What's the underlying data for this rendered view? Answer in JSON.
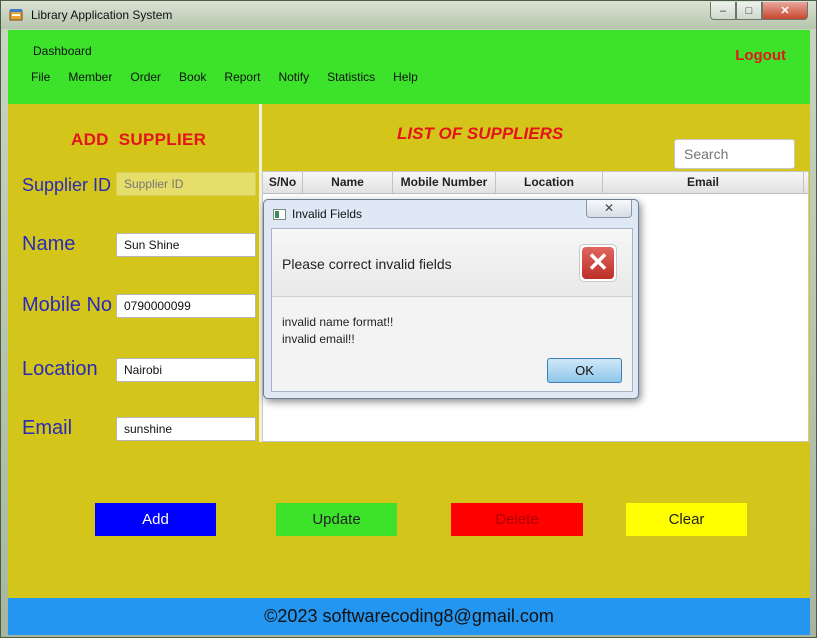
{
  "window": {
    "title": "Library Application System",
    "controls": {
      "minimize": "–",
      "maximize": "□",
      "close": "✕"
    }
  },
  "menubar": {
    "dashboard": "Dashboard",
    "items": [
      "File",
      "Member",
      "Order",
      "Book",
      "Report",
      "Notify",
      "Statistics",
      "Help"
    ],
    "logout": "Logout"
  },
  "form": {
    "title": "ADD  SUPPLIER",
    "fields": [
      {
        "label": "Supplier ID",
        "value": "",
        "placeholder": "Supplier ID",
        "disabled": true
      },
      {
        "label": "Name",
        "value": "Sun Shine",
        "placeholder": ""
      },
      {
        "label": "Mobile No",
        "value": "0790000099",
        "placeholder": ""
      },
      {
        "label": "Location",
        "value": "Nairobi",
        "placeholder": ""
      },
      {
        "label": "Email",
        "value": "sunshine",
        "placeholder": ""
      }
    ]
  },
  "list": {
    "title": "LIST OF SUPPLIERS",
    "search_placeholder": "Search",
    "columns": [
      "S/No",
      "Name",
      "Mobile Number",
      "Location",
      "Email"
    ],
    "rows": []
  },
  "buttons": {
    "add": "Add",
    "update": "Update",
    "delete": "Delete",
    "clear": "Clear"
  },
  "footer": "©2023 softwarecoding8@gmail.com",
  "dialog": {
    "title": "Invalid Fields",
    "close": "✕",
    "header": "Please correct invalid fields",
    "icon": "error-x-icon",
    "messages": [
      "invalid name format!!",
      "invalid email!!"
    ],
    "ok": "OK"
  },
  "colors": {
    "menubar": "#3ce32a",
    "panel": "#d4c51b",
    "heading_red": "#e3141b",
    "label_blue": "#2a2ab8",
    "add_button": "#0000ff",
    "update_button": "#3ce32a",
    "delete_button": "#ff0000",
    "clear_button": "#ffff00",
    "footer": "#2596f0"
  }
}
